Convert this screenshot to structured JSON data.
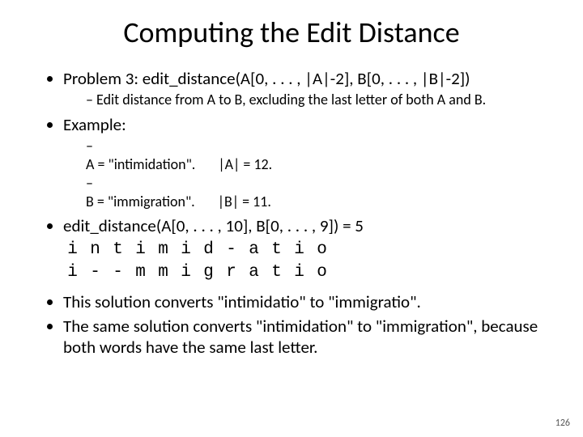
{
  "title": "Computing the Edit Distance",
  "b1": "Problem 3: edit_distance(A[0, . . . , |A|-2], B[0, . . . , |B|-2])",
  "b1s1": "Edit distance from A to B, excluding the last letter of both A and B.",
  "b2": "Example:",
  "ex_a_left": "A = \"intimidation\".",
  "ex_a_right": "|A| = 12.",
  "ex_b_left": "B = \"immigration\".",
  "ex_b_right": "|B| = 11.",
  "b3": "edit_distance(A[0, . . . , 10], B[0, . . . , 9]) = 5",
  "row1": [
    "i",
    "n",
    "t",
    "i",
    "m",
    "i",
    "d",
    "-",
    "a",
    "t",
    "i",
    "o"
  ],
  "row2": [
    "i",
    "-",
    "-",
    "m",
    "m",
    "i",
    "g",
    "r",
    "a",
    "t",
    "i",
    "o"
  ],
  "b4": "This solution converts \"intimidatio\" to \"immigratio\".",
  "b5": "The same solution converts \"intimidation\" to \"immigration\", because both words have the same last letter.",
  "page": "126"
}
